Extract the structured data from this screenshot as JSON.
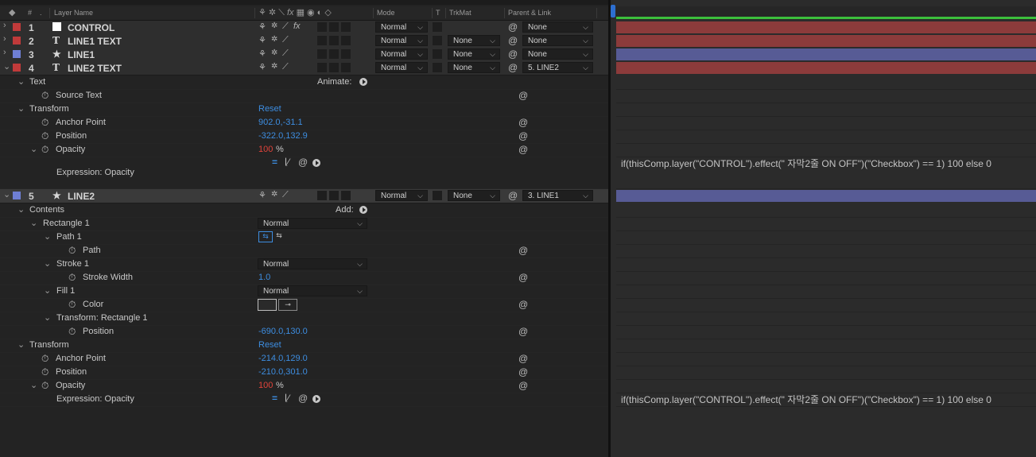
{
  "header": {
    "num": "#",
    "layer_name": "Layer Name",
    "mode": "Mode",
    "t": "T",
    "trkmat": "TrkMat",
    "parent": "Parent & Link"
  },
  "layers": [
    {
      "index": "1",
      "name": "CONTROL",
      "color": "#c03a3a",
      "type": "solid",
      "mode": "Normal",
      "trkmat": "",
      "parent": "None",
      "bar_color": "#8c3b3b"
    },
    {
      "index": "2",
      "name": "LINE1 TEXT",
      "color": "#c03a3a",
      "type": "text",
      "mode": "Normal",
      "trkmat": "None",
      "parent": "None",
      "bar_color": "#8c3b3b"
    },
    {
      "index": "3",
      "name": "LINE1",
      "color": "#6f7fd4",
      "type": "shape",
      "mode": "Normal",
      "trkmat": "None",
      "parent": "None",
      "bar_color": "#575b95"
    },
    {
      "index": "4",
      "name": "LINE2 TEXT",
      "color": "#c03a3a",
      "type": "text",
      "mode": "Normal",
      "trkmat": "None",
      "parent": "5. LINE2",
      "bar_color": "#8c3b3b"
    },
    {
      "index": "5",
      "name": "LINE2",
      "color": "#6f7fd4",
      "type": "shape",
      "mode": "Normal",
      "trkmat": "None",
      "parent": "3. LINE1",
      "bar_color": "#575b95"
    }
  ],
  "layer4_props": {
    "text": "Text",
    "animate": "Animate:",
    "source_text": "Source Text",
    "transform": "Transform",
    "reset": "Reset",
    "anchor_point": "Anchor Point",
    "anchor_value": "902.0,-31.1",
    "position": "Position",
    "position_value": "-322.0,132.9",
    "opacity": "Opacity",
    "opacity_value": "100",
    "percent": "%",
    "expression_label": "Expression: Opacity",
    "expression": "if(thisComp.layer(\"CONTROL\").effect(\" 자막2줄 ON OFF\")(\"Checkbox\") == 1) 100 else 0"
  },
  "layer5_props": {
    "contents": "Contents",
    "add": "Add:",
    "rectangle": "Rectangle 1",
    "rectangle_mode": "Normal",
    "path1": "Path 1",
    "path": "Path",
    "stroke1": "Stroke 1",
    "stroke_mode": "Normal",
    "stroke_width": "Stroke Width",
    "stroke_width_value": "1.0",
    "fill1": "Fill 1",
    "fill_mode": "Normal",
    "color": "Color",
    "transform_rect": "Transform: Rectangle 1",
    "rect_position": "Position",
    "rect_position_value": "-690.0,130.0",
    "transform": "Transform",
    "reset": "Reset",
    "anchor_point": "Anchor Point",
    "anchor_value": "-214.0,129.0",
    "position": "Position",
    "position_value": "-210.0,301.0",
    "opacity": "Opacity",
    "opacity_value": "100",
    "percent": "%",
    "expression_label": "Expression: Opacity",
    "expression": "if(thisComp.layer(\"CONTROL\").effect(\" 자막2줄 ON OFF\")(\"Checkbox\") == 1) 100 else 0"
  },
  "colors": {
    "value_blue": "#3d8de0",
    "value_red": "#e0433a",
    "work_area_green": "#3cbf3c"
  }
}
